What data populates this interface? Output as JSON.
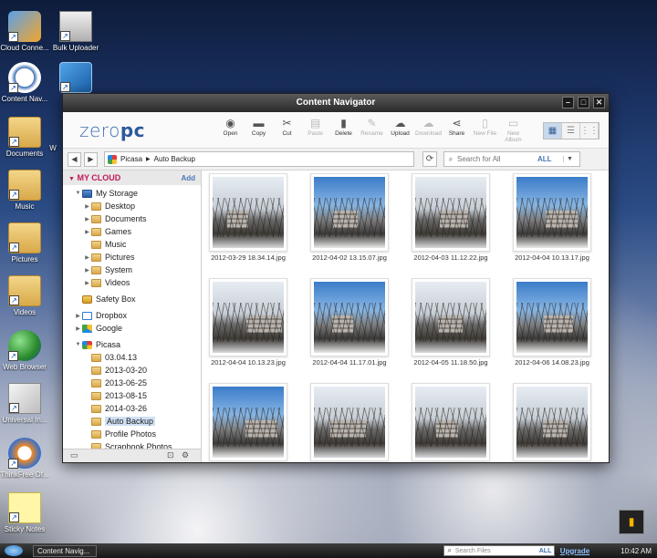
{
  "desktop": {
    "icons": [
      {
        "label": "Cloud Conne...",
        "icon": "cloud-connect-icon"
      },
      {
        "label": "Bulk Uploader",
        "icon": "bulk-uploader-icon"
      },
      {
        "label": "Content Nav...",
        "icon": "content-navigator-icon"
      },
      {
        "label": "",
        "icon": "photo-app-icon"
      },
      {
        "label": "Documents",
        "icon": "folder-icon"
      },
      {
        "label": "Music",
        "icon": "folder-icon"
      },
      {
        "label": "Pictures",
        "icon": "folder-icon"
      },
      {
        "label": "Videos",
        "icon": "folder-icon"
      },
      {
        "label": "Web Browser",
        "icon": "globe-icon"
      },
      {
        "label": "Universal In...",
        "icon": "mail-icon"
      },
      {
        "label": "ThinkFree Of...",
        "icon": "office-icon"
      },
      {
        "label": "Sticky Notes",
        "icon": "notes-icon"
      }
    ],
    "partial_label": "W"
  },
  "window": {
    "title": "Content Navigator",
    "logo": {
      "part1": "zero",
      "part2": "pc"
    },
    "toolbar": [
      {
        "label": "Open",
        "icon": "open-icon",
        "enabled": true
      },
      {
        "label": "Copy",
        "icon": "copy-icon",
        "enabled": true
      },
      {
        "label": "Cut",
        "icon": "cut-icon",
        "enabled": true
      },
      {
        "label": "Paste",
        "icon": "paste-icon",
        "enabled": false
      },
      {
        "label": "Delete",
        "icon": "delete-icon",
        "enabled": true
      },
      {
        "label": "Rename",
        "icon": "rename-icon",
        "enabled": false
      },
      {
        "label": "Upload",
        "icon": "upload-icon",
        "enabled": true
      },
      {
        "label": "Download",
        "icon": "download-icon",
        "enabled": false
      },
      {
        "label": "Share",
        "icon": "share-icon",
        "enabled": true
      },
      {
        "label": "New File",
        "icon": "new-file-icon",
        "enabled": false
      },
      {
        "label": "New Album",
        "icon": "new-album-icon",
        "enabled": false
      }
    ],
    "breadcrumb": [
      "Picasa",
      "Auto Backup"
    ],
    "search": {
      "placeholder": "Search for All",
      "scope": "ALL"
    },
    "sidebar": {
      "header": "MY CLOUD",
      "add_label": "Add",
      "tree": [
        {
          "label": "My Storage",
          "level": 0,
          "expanded": true,
          "icon": "storage-icon"
        },
        {
          "label": "Desktop",
          "level": 1,
          "icon": "folder-icon"
        },
        {
          "label": "Documents",
          "level": 1,
          "icon": "folder-icon"
        },
        {
          "label": "Games",
          "level": 1,
          "icon": "folder-icon"
        },
        {
          "label": "Music",
          "level": 1,
          "icon": "folder-icon"
        },
        {
          "label": "Pictures",
          "level": 1,
          "icon": "folder-icon"
        },
        {
          "label": "System",
          "level": 1,
          "icon": "folder-icon"
        },
        {
          "label": "Videos",
          "level": 1,
          "icon": "folder-icon"
        },
        {
          "label": "Safety Box",
          "level": 0,
          "icon": "lock-icon"
        },
        {
          "label": "Dropbox",
          "level": 0,
          "icon": "dropbox-icon"
        },
        {
          "label": "Google",
          "level": 0,
          "icon": "google-drive-icon"
        },
        {
          "label": "Picasa",
          "level": 0,
          "expanded": true,
          "icon": "picasa-icon"
        },
        {
          "label": "03.04.13",
          "level": 1,
          "icon": "folder-icon"
        },
        {
          "label": "2013-03-20",
          "level": 1,
          "icon": "folder-icon"
        },
        {
          "label": "2013-06-25",
          "level": 1,
          "icon": "folder-icon"
        },
        {
          "label": "2013-08-15",
          "level": 1,
          "icon": "folder-icon"
        },
        {
          "label": "2014-03-26",
          "level": 1,
          "icon": "folder-icon"
        },
        {
          "label": "Auto Backup",
          "level": 1,
          "icon": "folder-icon",
          "selected": true
        },
        {
          "label": "Profile Photos",
          "level": 1,
          "icon": "folder-icon"
        },
        {
          "label": "Scrapbook Photos",
          "level": 1,
          "icon": "folder-icon"
        }
      ]
    },
    "files": [
      "2012-03-29 18.34.14.jpg",
      "2012-04-02 13.15.07.jpg",
      "2012-04-03 11.12.22.jpg",
      "2012-04-04 10.13.17.jpg",
      "2012-04-04 10.13.23.jpg",
      "2012-04-04 11.17.01.jpg",
      "2012-04-05 11.18.50.jpg",
      "2012-04-06 14.08.23.jpg",
      "",
      "",
      "",
      ""
    ]
  },
  "taskbar": {
    "task": "Content Navig...",
    "search_placeholder": "Search Files",
    "search_scope": "ALL",
    "upgrade": "Upgrade",
    "clock": "10:42 AM"
  }
}
